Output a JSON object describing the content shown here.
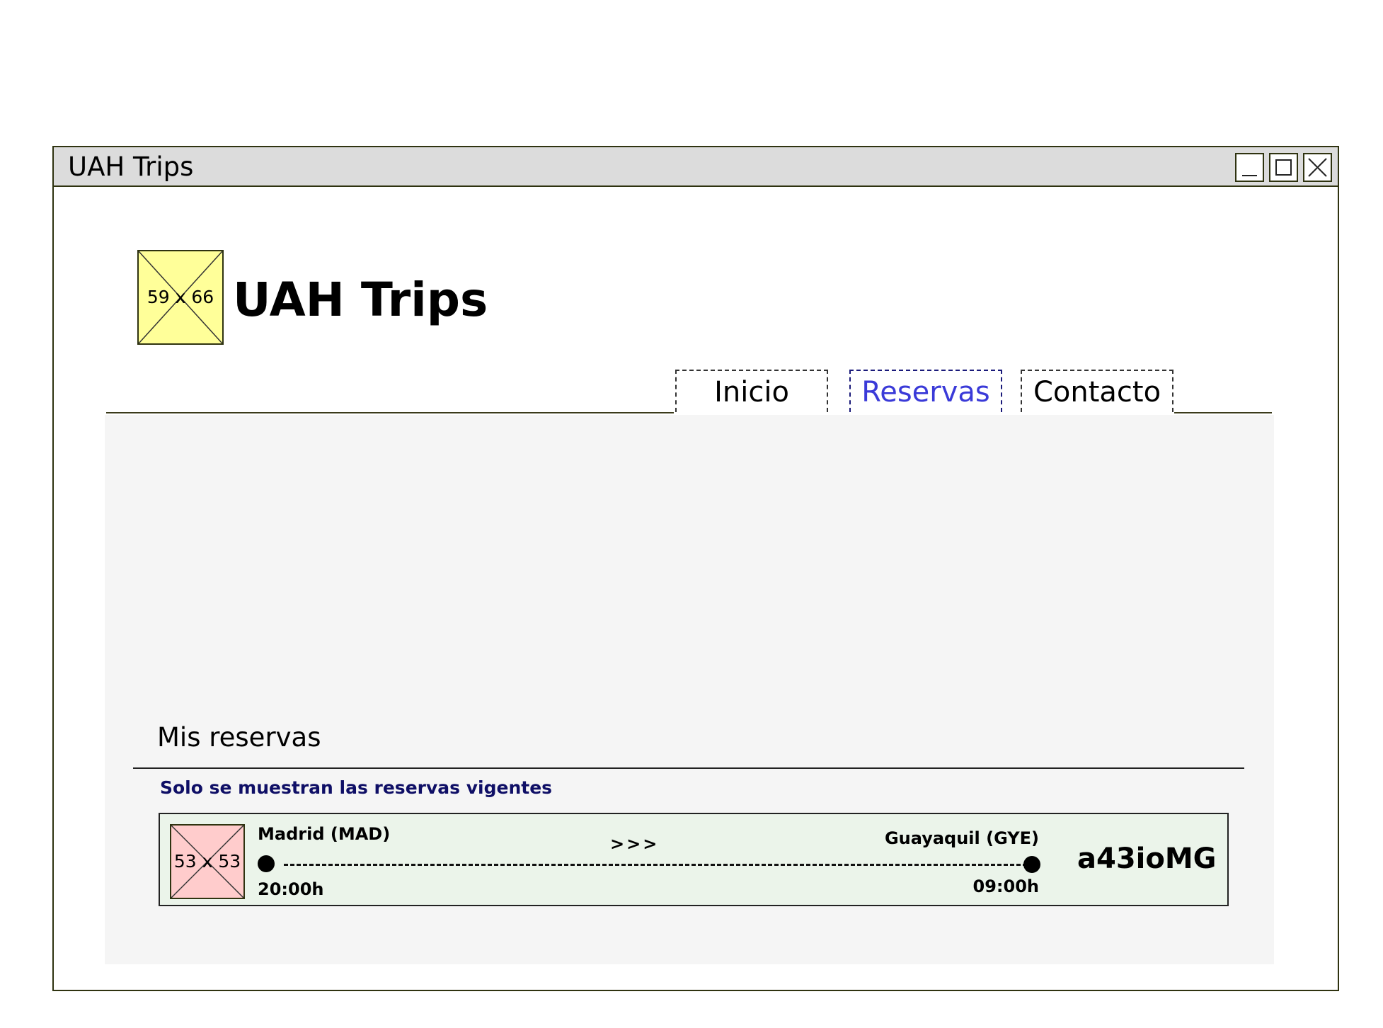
{
  "window": {
    "title": "UAH Trips",
    "controls": [
      "minimize-icon",
      "maximize-icon",
      "close-icon"
    ]
  },
  "header": {
    "logo_placeholder": "59 x 66",
    "brand": "UAH Trips"
  },
  "nav": {
    "tabs": [
      {
        "label": "Inicio",
        "active": false
      },
      {
        "label": "Reservas",
        "active": true
      },
      {
        "label": "Contacto",
        "active": false
      }
    ]
  },
  "main": {
    "title": "Mis reservas",
    "note": "Solo se muestran las reservas vigentes",
    "reservations": [
      {
        "image_placeholder": "53 x 53",
        "origin": "Madrid (MAD)",
        "departure_time": "20:00h",
        "arrows": ">>>",
        "destination": "Guayaquil (GYE)",
        "arrival_time": "09:00h",
        "code": "a43ioMG"
      }
    ]
  },
  "colors": {
    "active_tab": "#3a3ad8",
    "note_text": "#0f0f66",
    "card_bg": "#ebf4ea",
    "logo_placeholder_bg": "#ffff99",
    "image_placeholder_bg": "#ffcccc"
  }
}
